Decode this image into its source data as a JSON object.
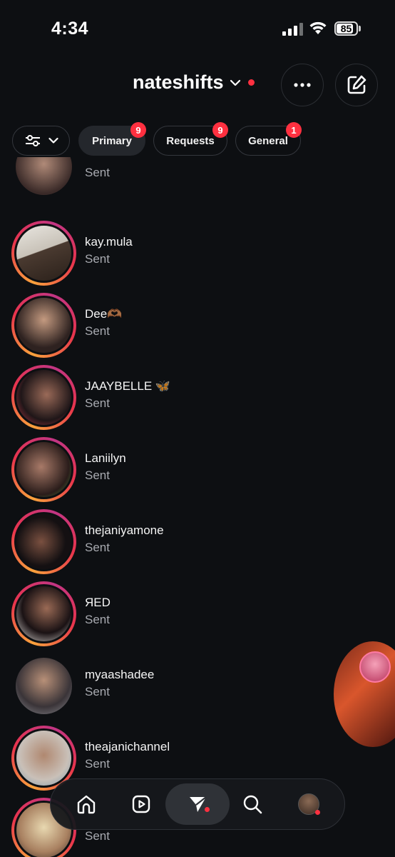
{
  "status_bar": {
    "time": "4:34",
    "battery": "85"
  },
  "header": {
    "username": "nateshifts"
  },
  "filters": {
    "chips": [
      {
        "label": "Primary",
        "badge": "9",
        "active": true
      },
      {
        "label": "Requests",
        "badge": "9",
        "active": false
      },
      {
        "label": "General",
        "badge": "1",
        "active": false
      }
    ]
  },
  "conversations": [
    {
      "name": "",
      "status": "Sent",
      "ring": false
    },
    {
      "name": "kay.mula",
      "status": "Sent",
      "ring": true
    },
    {
      "name": "Dee🫶🏾",
      "status": "Sent",
      "ring": true
    },
    {
      "name": "JAAYBELLE 🦋",
      "status": "Sent",
      "ring": true
    },
    {
      "name": "Laniilyn",
      "status": "Sent",
      "ring": true
    },
    {
      "name": "thejaniyamone",
      "status": "Sent",
      "ring": true
    },
    {
      "name": "ЯED",
      "status": "Sent",
      "ring": true
    },
    {
      "name": "myaashadee",
      "status": "Sent",
      "ring": false
    },
    {
      "name": "theajanichannel",
      "status": "Sent",
      "ring": true
    },
    {
      "name": "",
      "status": "Sent",
      "ring": true
    }
  ],
  "nav": {
    "items": [
      "home-icon",
      "reels-icon",
      "messages-icon",
      "search-icon",
      "profile-avatar"
    ]
  }
}
